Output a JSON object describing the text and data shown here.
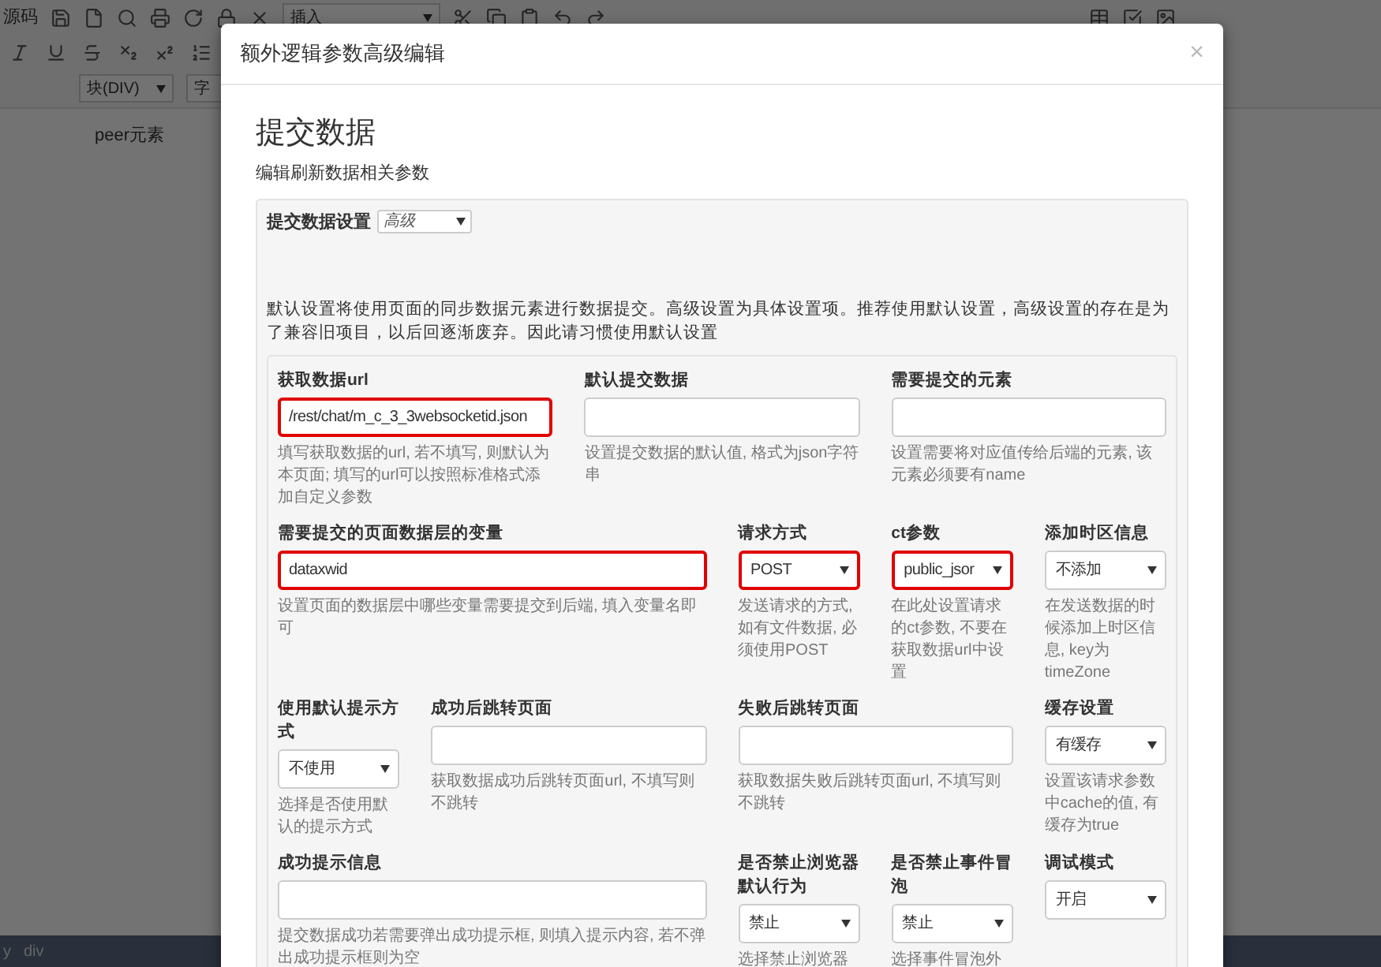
{
  "editor": {
    "toolbar_label": "源码",
    "insert_select": "插入",
    "block_select": "块(DIV)",
    "font_select": "字",
    "content_text": "peer元素",
    "status_path": [
      "y",
      "div"
    ]
  },
  "dialog": {
    "title": "额外逻辑参数高级编辑",
    "close": "×"
  },
  "section": {
    "heading": "提交数据",
    "subtitle": "编辑刷新数据相关参数"
  },
  "settings": {
    "label": "提交数据设置",
    "select_value": "高级",
    "description": "默认设置将使用页面的同步数据元素进行数据提交。高级设置为具体设置项。推荐使用默认设置，高级设置的存在是为了兼容旧项目，以后回逐渐废弃。因此请习惯使用默认设置"
  },
  "fields": [
    {
      "kind": "input",
      "label": "获取数据url",
      "value": "/rest/chat/m_c_3_3websocketid.json",
      "hint": "填写获取数据的url, 若不填写, 则默认为本页面; 填写的url可以按照标准格式添加自定义参数",
      "highlighted": true
    },
    {
      "kind": "input",
      "label": "默认提交数据",
      "hint": "设置提交数据的默认值, 格式为json字符串",
      "highlighted": false
    },
    {
      "kind": "input",
      "label": "需要提交的元素",
      "hint": "设置需要将对应值传给后端的元素, 该元素必须要有name",
      "highlighted": false
    },
    {
      "kind": "input",
      "label": "需要提交的页面数据层的变量",
      "value": "dataxwid",
      "hint": "设置页面的数据层中哪些变量需要提交到后端, 填入变量名即可",
      "highlighted": true
    },
    {
      "kind": "select",
      "label": "请求方式",
      "value": "POST",
      "hint": "发送请求的方式, 如有文件数据, 必须使用POST",
      "highlighted": true
    },
    {
      "kind": "select",
      "label": "ct参数",
      "value": "public_jsor",
      "hint": "在此处设置请求的ct参数, 不要在获取数据url中设置",
      "highlighted": true
    },
    {
      "kind": "select",
      "label": "添加时区信息",
      "value": "不添加",
      "hint": "在发送数据的时候添加上时区信息, key为timeZone",
      "highlighted": false
    },
    {
      "kind": "select",
      "label": "使用默认提示方式",
      "value": "不使用",
      "hint": "选择是否使用默认的提示方式",
      "highlighted": false
    },
    {
      "kind": "input",
      "label": "成功后跳转页面",
      "hint": "获取数据成功后跳转页面url, 不填写则不跳转",
      "highlighted": false
    },
    {
      "kind": "input",
      "label": "失败后跳转页面",
      "hint": "获取数据失败后跳转页面url, 不填写则不跳转",
      "highlighted": false
    },
    {
      "kind": "select",
      "label": "缓存设置",
      "value": "有缓存",
      "hint": "设置该请求参数中cache的值, 有缓存为true",
      "highlighted": false
    },
    {
      "kind": "input",
      "label": "成功提示信息",
      "hint": "提交数据成功若需要弹出成功提示框, 则填入提示内容, 若不弹出成功提示框则为空",
      "highlighted": false
    },
    {
      "kind": "select",
      "label": "是否禁止浏览器默认行为",
      "value": "禁止",
      "hint": "选择禁止浏览器",
      "highlighted": false
    },
    {
      "kind": "select",
      "label": "是否禁止事件冒泡",
      "value": "禁止",
      "hint": "选择事件冒泡外",
      "highlighted": false
    },
    {
      "kind": "select",
      "label": "调试模式",
      "value": "开启",
      "highlighted": false
    }
  ]
}
